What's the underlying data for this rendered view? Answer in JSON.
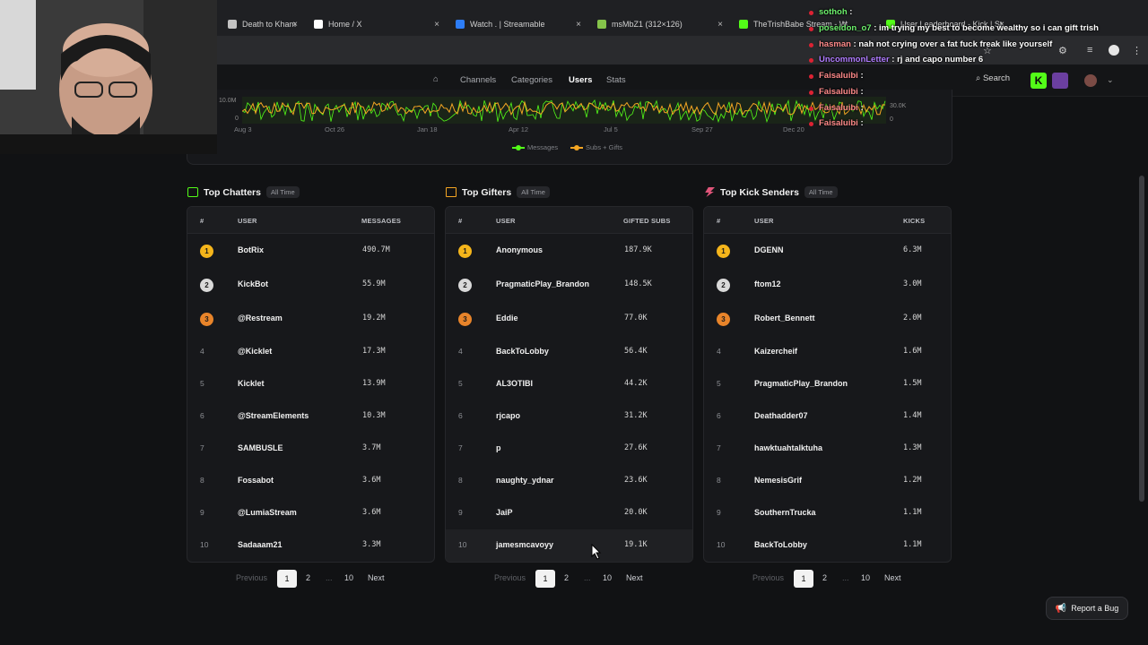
{
  "browser": {
    "tabs": [
      {
        "label": "Death to Khamenei |",
        "x": 244,
        "w": 96,
        "fav": "#c3c3c3"
      },
      {
        "label": "Home / X",
        "x": 340,
        "w": 158,
        "fav": "#ffffff"
      },
      {
        "label": "Watch . | Streamable",
        "x": 498,
        "w": 158,
        "fav": "#2d7df6"
      },
      {
        "label": "msMbZ1 (312×126)",
        "x": 656,
        "w": 158,
        "fav": "#85c34a"
      },
      {
        "label": "TheTrishBabe Stream - Watch...",
        "x": 814,
        "w": 140,
        "fav": "#53fc18"
      },
      {
        "label": "User Leaderboard - Kick | Strea...",
        "x": 978,
        "w": 150,
        "fav": "#53fc18"
      }
    ]
  },
  "nav": {
    "links": [
      {
        "label": "Channels",
        "active": false
      },
      {
        "label": "Categories",
        "active": false
      },
      {
        "label": "Users",
        "active": true
      },
      {
        "label": "Stats",
        "active": false
      }
    ],
    "search_label": "Search",
    "kick_icon_label": "K"
  },
  "chart_data": {
    "type": "line",
    "title": "",
    "x_ticks": [
      "Aug 3",
      "Oct 26",
      "Jan 18",
      "Apr 12",
      "Jul 5",
      "Sep 27",
      "Dec 20"
    ],
    "y_left_ticks": [
      "10.0M",
      "0"
    ],
    "y_right_ticks": [
      "30.0K",
      "0"
    ],
    "series": [
      {
        "name": "Messages",
        "color": "#53fc18"
      },
      {
        "name": "Subs + Gifts",
        "color": "#f5a623"
      }
    ]
  },
  "leaderboards": [
    {
      "title": "Top Chatters",
      "badge": "All Time",
      "icon_color": "#53fc18",
      "col_rank": "#",
      "col_user": "USER",
      "col_value": "MESSAGES",
      "rows": [
        {
          "rank": "1",
          "user": "BotRix",
          "value": "490.7M"
        },
        {
          "rank": "2",
          "user": "KickBot",
          "value": "55.9M"
        },
        {
          "rank": "3",
          "user": "@Restream",
          "value": "19.2M"
        },
        {
          "rank": "4",
          "user": "@Kicklet",
          "value": "17.3M"
        },
        {
          "rank": "5",
          "user": "Kicklet",
          "value": "13.9M"
        },
        {
          "rank": "6",
          "user": "@StreamElements",
          "value": "10.3M"
        },
        {
          "rank": "7",
          "user": "SAMBUSLE",
          "value": "3.7M"
        },
        {
          "rank": "8",
          "user": "Fossabot",
          "value": "3.6M"
        },
        {
          "rank": "9",
          "user": "@LumiaStream",
          "value": "3.6M"
        },
        {
          "rank": "10",
          "user": "Sadaaam21",
          "value": "3.3M"
        }
      ],
      "pager": {
        "prev": "Previous",
        "pages": [
          "1",
          "2",
          "...",
          "10"
        ],
        "next": "Next"
      }
    },
    {
      "title": "Top Gifters",
      "badge": "All Time",
      "icon_color": "#f5a623",
      "col_rank": "#",
      "col_user": "USER",
      "col_value": "GIFTED SUBS",
      "rows": [
        {
          "rank": "1",
          "user": "Anonymous",
          "value": "187.9K"
        },
        {
          "rank": "2",
          "user": "PragmaticPlay_Brandon",
          "value": "148.5K"
        },
        {
          "rank": "3",
          "user": "Eddie",
          "value": "77.0K"
        },
        {
          "rank": "4",
          "user": "BackToLobby",
          "value": "56.4K"
        },
        {
          "rank": "5",
          "user": "AL3OTIBI",
          "value": "44.2K"
        },
        {
          "rank": "6",
          "user": "rjcapo",
          "value": "31.2K"
        },
        {
          "rank": "7",
          "user": "p",
          "value": "27.6K"
        },
        {
          "rank": "8",
          "user": "naughty_ydnar",
          "value": "23.6K"
        },
        {
          "rank": "9",
          "user": "JaiP",
          "value": "20.0K"
        },
        {
          "rank": "10",
          "user": "jamesmcavoyy",
          "value": "19.1K"
        }
      ],
      "pager": {
        "prev": "Previous",
        "pages": [
          "1",
          "2",
          "...",
          "10"
        ],
        "next": "Next"
      }
    },
    {
      "title": "Top Kick Senders",
      "badge": "All Time",
      "icon_color": "#e0557a",
      "col_rank": "#",
      "col_user": "USER",
      "col_value": "KICKS",
      "rows": [
        {
          "rank": "1",
          "user": "DGENN",
          "value": "6.3M"
        },
        {
          "rank": "2",
          "user": "ftom12",
          "value": "3.0M"
        },
        {
          "rank": "3",
          "user": "Robert_Bennett",
          "value": "2.0M"
        },
        {
          "rank": "4",
          "user": "Kaizercheif",
          "value": "1.6M"
        },
        {
          "rank": "5",
          "user": "PragmaticPlay_Brandon",
          "value": "1.5M"
        },
        {
          "rank": "6",
          "user": "Deathadder07",
          "value": "1.4M"
        },
        {
          "rank": "7",
          "user": "hawktuahtalktuha",
          "value": "1.3M"
        },
        {
          "rank": "8",
          "user": "NemesisGrif",
          "value": "1.2M"
        },
        {
          "rank": "9",
          "user": "SouthernTrucka",
          "value": "1.1M"
        },
        {
          "rank": "10",
          "user": "BackToLobby",
          "value": "1.1M"
        }
      ],
      "pager": {
        "prev": "Previous",
        "pages": [
          "1",
          "2",
          "...",
          "10"
        ],
        "next": "Next"
      }
    }
  ],
  "report_bug": "Report a Bug",
  "medal_colors": [
    "#f5b51b",
    "#d9d9d9",
    "#e8842a"
  ],
  "stream_chat": [
    {
      "user": "sothoh",
      "color": "#6cf06c",
      "msg": ""
    },
    {
      "user": "poseidon_o7",
      "color": "#6cf06c",
      "msg": "im trying my best to become wealthy so i can gift trish"
    },
    {
      "user": "hasman",
      "color": "#ff8a8a",
      "msg": "nah not crying over a fat fuck freak like yourself"
    },
    {
      "user": "UncommonLetter",
      "color": "#b07cff",
      "msg": "rj and capo number 6"
    },
    {
      "user": "Faisaluibi",
      "color": "#ff8a8a",
      "msg": ""
    },
    {
      "user": "Faisaluibi",
      "color": "#ff8a8a",
      "msg": ""
    },
    {
      "user": "Faisaluibi",
      "color": "#ff8a8a",
      "msg": ""
    },
    {
      "user": "Faisaluibi",
      "color": "#ff8a8a",
      "msg": ""
    }
  ]
}
